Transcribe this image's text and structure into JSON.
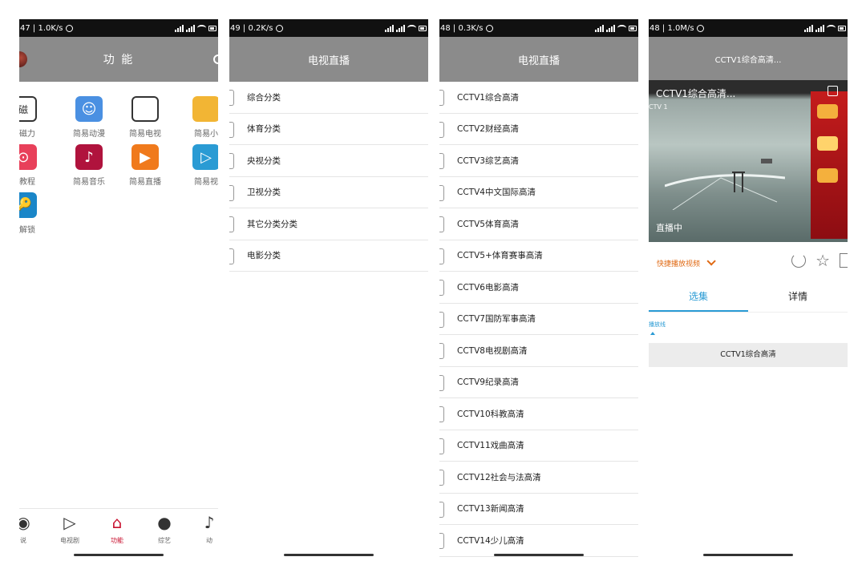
{
  "screen1": {
    "status": {
      "speed": "47 | 1.0K/s"
    },
    "title": "功 能",
    "grid": [
      {
        "label": "易磁力",
        "icon": "magnet-app-icon",
        "color": "#ffffff",
        "glyph": "磁"
      },
      {
        "label": "简易动漫",
        "icon": "anime-app-icon",
        "color": "#4a90e2",
        "glyph": "☺"
      },
      {
        "label": "简易电视",
        "icon": "tv-app-icon",
        "color": "#ffffff",
        "glyph": ""
      },
      {
        "label": "简易小",
        "icon": "book-app-icon",
        "color": "#f2b534",
        "glyph": ""
      },
      {
        "label": "易教程",
        "icon": "tutorial-app-icon",
        "color": "#e8405a",
        "glyph": "⊙"
      },
      {
        "label": "简易音乐",
        "icon": "music-app-icon",
        "color": "#b0133d",
        "glyph": "♪"
      },
      {
        "label": "简易直播",
        "icon": "live-app-icon",
        "color": "#f07a1c",
        "glyph": "▶"
      },
      {
        "label": "简易视",
        "icon": "video-app-icon",
        "color": "#2a9bd4",
        "glyph": "▷"
      },
      {
        "label": "存解锁",
        "icon": "key-app-icon",
        "color": "#1a86c8",
        "glyph": "🔑"
      }
    ],
    "nav": [
      {
        "label": "说",
        "icon": "film-icon"
      },
      {
        "label": "电视剧",
        "icon": "play-circle-icon"
      },
      {
        "label": "功能",
        "icon": "home-icon"
      },
      {
        "label": "综艺",
        "icon": "palette-icon"
      },
      {
        "label": "动",
        "icon": "music-note-icon"
      }
    ],
    "nav_active_color": "#c8102e"
  },
  "screen2": {
    "status": {
      "speed": "49 | 0.2K/s"
    },
    "title": "电视直播",
    "items": [
      "综合分类",
      "体育分类",
      "央视分类",
      "卫视分类",
      "其它分类分类",
      "电影分类"
    ]
  },
  "screen3": {
    "status": {
      "speed": "48 | 0.3K/s"
    },
    "title": "电视直播",
    "items": [
      "CCTV1综合高清",
      "CCTV2财经高清",
      "CCTV3综艺高清",
      "CCTV4中文国际高清",
      "CCTV5体育高清",
      "CCTV5+体育赛事高清",
      "CCTV6电影高清",
      "CCTV7国防军事高清",
      "CCTV8电视剧高清",
      "CCTV9纪录高清",
      "CCTV10科教高清",
      "CCTV11戏曲高清",
      "CCTV12社会与法高清",
      "CCTV13新闻高清",
      "CCTV14少儿高清"
    ]
  },
  "screen4": {
    "status": {
      "speed": "48 | 1.0M/s"
    },
    "title": "CCTV1综合高清...",
    "video_title": "CCTV1综合高清...",
    "cctv_mark": "CTV 1",
    "live_label": "直播中",
    "quick_play": "快捷播放视频",
    "tabs": [
      "选集",
      "详情"
    ],
    "source_label": "播放线",
    "episode": "CCTV1综合高清",
    "accent": "#2a9bd4",
    "orange": "#e06a14"
  }
}
